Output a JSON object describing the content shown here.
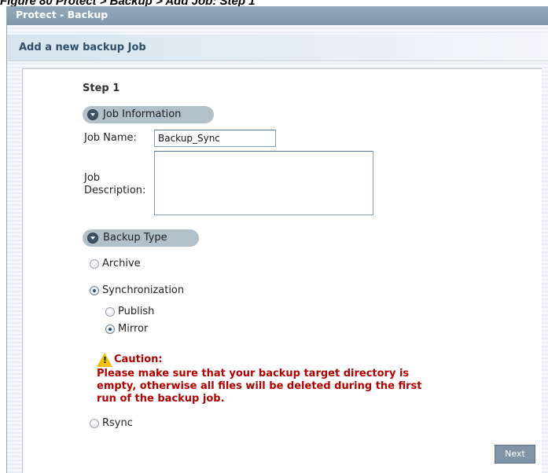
{
  "caption": {
    "text": "Figure 80   Protect > Backup > Add Job: Step 1"
  },
  "window": {
    "title": "Protect - Backup"
  },
  "section": {
    "header": "Add a new backup Job"
  },
  "step": {
    "label": "Step 1"
  },
  "job_information": {
    "header": "Job Information",
    "name_label": "Job Name:",
    "name_value": "Backup_Sync",
    "description_label_line1": "Job",
    "description_label_line2": "Description:",
    "description_value": ""
  },
  "backup_type": {
    "header": "Backup Type",
    "options": {
      "archive": "Archive",
      "synchronization": "Synchronization",
      "publish": "Publish",
      "mirror": "Mirror",
      "rsync": "Rsync"
    },
    "selected": "synchronization",
    "sync_mode_selected": "mirror"
  },
  "caution": {
    "title": "Caution:",
    "line1": "Please make sure that your backup target directory is",
    "line2": "empty, otherwise all files will be deleted during the first",
    "line3": "run of the backup job."
  },
  "buttons": {
    "next": "Next"
  },
  "colors": {
    "title_bar": "#8aa1b5",
    "section_header_text": "#2d4f6c",
    "pill": "#b2c0ca",
    "caution_text": "#b10000",
    "button": "#8193a7"
  },
  "icons": {
    "section_toggle": "chevron-down-circle-icon",
    "warning": "warning-triangle-icon"
  }
}
